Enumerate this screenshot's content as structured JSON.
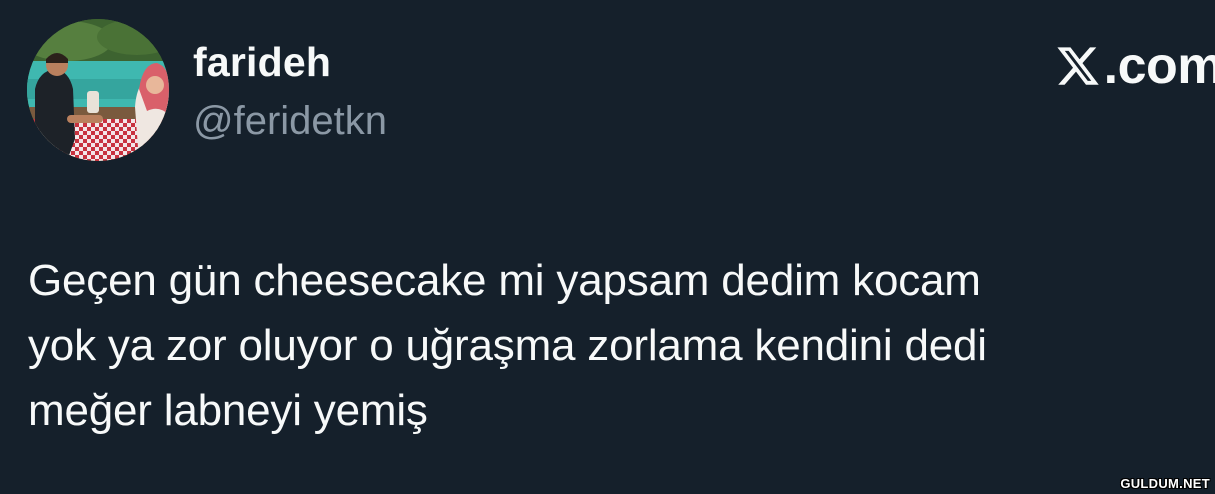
{
  "author": {
    "display_name": "farideh",
    "handle": "@feridetkn"
  },
  "brand": {
    "icon": "x-logo-icon",
    "text": ".com"
  },
  "tweet": {
    "lines": [
      "Geçen gün cheesecake mi yapsam dedim kocam",
      "yok ya zor oluyor o uğraşma zorlama kendini dedi",
      "meğer labneyi yemiş"
    ]
  },
  "watermark": {
    "text": "GULDUM.NET"
  },
  "colors": {
    "background": "#15202b",
    "text_primary": "#f7f9f9",
    "text_secondary": "#8b98a5"
  }
}
